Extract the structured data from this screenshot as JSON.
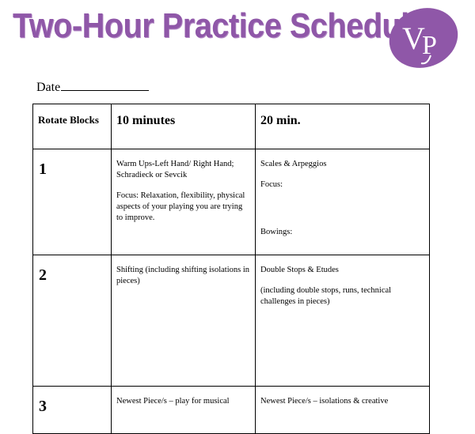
{
  "header": {
    "title": "Two-Hour Practice Schedule",
    "logo_text": "VP",
    "brand_color": "#8f57a8"
  },
  "date_label": "Date",
  "table": {
    "headers": [
      "Rotate Blocks",
      "10 minutes",
      "20 min."
    ],
    "rows": [
      {
        "block": "1",
        "col2": [
          "Warm Ups-Left Hand/ Right Hand; Schradieck or Sevcik",
          "Focus: Relaxation, flexibility, physical aspects of your playing you are trying to improve."
        ],
        "col3": [
          "Scales & Arpeggios",
          "Focus:",
          "Bowings:"
        ]
      },
      {
        "block": "2",
        "col2": [
          "Shifting (including shifting isolations in pieces)"
        ],
        "col3": [
          "Double Stops & Etudes",
          "(including double stops, runs, technical challenges in pieces)"
        ]
      },
      {
        "block": "3",
        "col2": [
          "Newest Piece/s – play for musical"
        ],
        "col3": [
          "Newest Piece/s – isolations & creative"
        ]
      }
    ]
  }
}
